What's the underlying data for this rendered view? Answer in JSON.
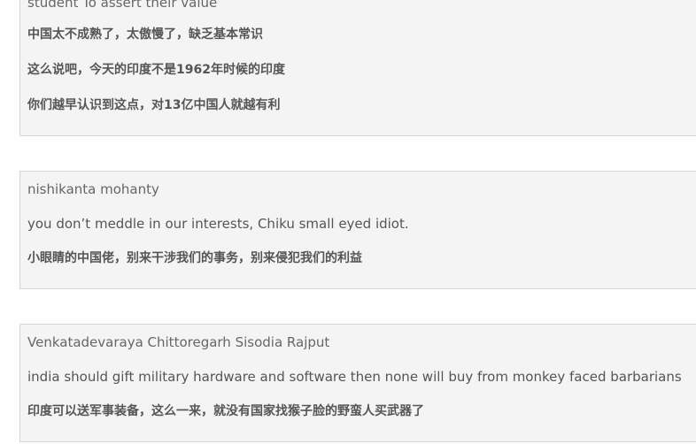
{
  "comments": [
    {
      "partial_text": "student To assert their value",
      "lines": [
        "中国太不成熟了，太傲慢了，缺乏基本常识",
        "这么说吧，今天的印度不是1962年时候的印度",
        "你们越早认识到这点，对13亿中国人就越有利"
      ]
    },
    {
      "author": "nishikanta mohanty",
      "text": "you don’t meddle in our interests, Chiku small eyed idiot.",
      "translation": "小眼睛的中国佬，别来干涉我们的事务，别来侵犯我们的利益"
    },
    {
      "author": "Venkatadevaraya Chittoregarh Sisodia Rajput",
      "text": "india should gift military hardware and software then none will buy from monkey faced barbarians",
      "translation": "印度可以送军事装备，这么一来，就没有国家找猴子脸的野蛮人买武器了"
    }
  ]
}
